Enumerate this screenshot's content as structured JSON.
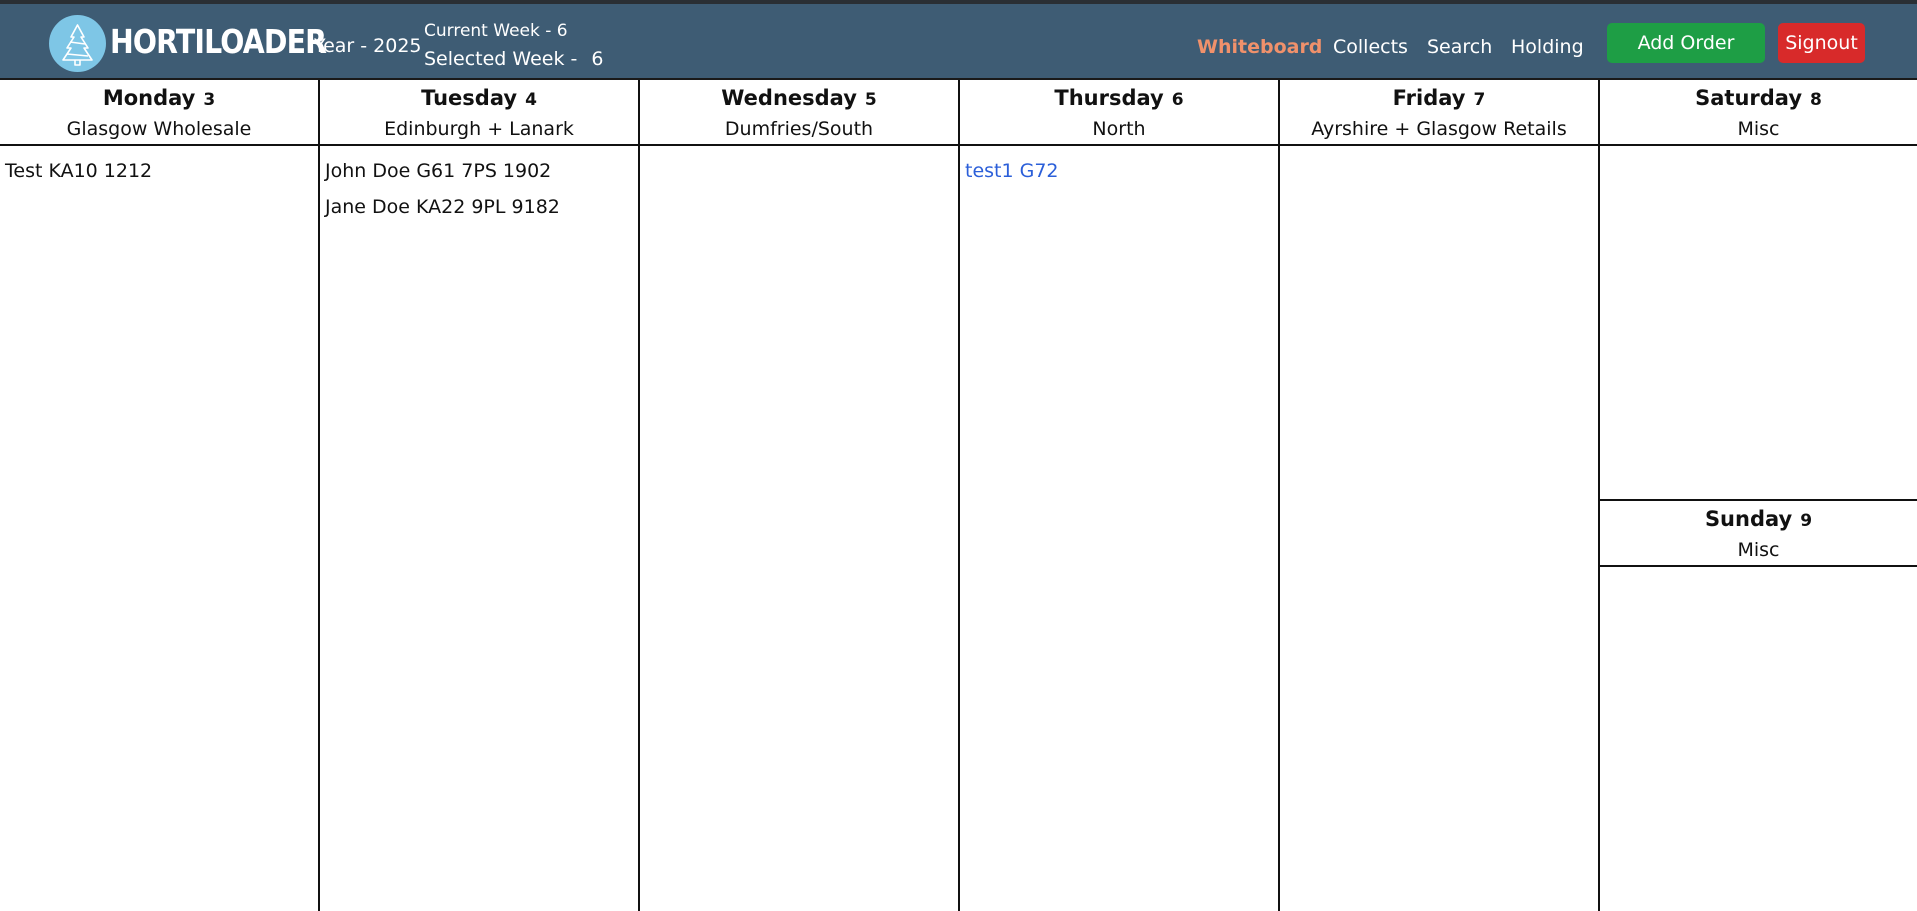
{
  "header": {
    "brand": "HORTILOADER",
    "year_text": "Year - 2025",
    "current_week_text": "Current Week - 6",
    "selected_week_label": "Selected Week -",
    "selected_week_value": "6",
    "nav": [
      "Whiteboard",
      "Collects",
      "Search",
      "Holding"
    ],
    "active_nav": "Whiteboard",
    "add_order_label": "Add Order",
    "signout_label": "Signout",
    "colors": {
      "navbar": "#3e5c74",
      "active": "#f0916b",
      "add": "#1e9e45",
      "signout": "#d82a2a",
      "order_link": "#2b5fd9"
    }
  },
  "days": [
    {
      "name": "Monday",
      "num": "3",
      "region": "Glasgow Wholesale",
      "orders": [
        {
          "text": "Test KA10 1212"
        }
      ]
    },
    {
      "name": "Tuesday",
      "num": "4",
      "region": "Edinburgh + Lanark",
      "orders": [
        {
          "text": "John Doe G61 7PS 1902"
        },
        {
          "text": "Jane Doe KA22 9PL 9182"
        }
      ]
    },
    {
      "name": "Wednesday",
      "num": "5",
      "region": "Dumfries/South",
      "orders": []
    },
    {
      "name": "Thursday",
      "num": "6",
      "region": "North",
      "orders": [
        {
          "text": "test1 G72",
          "highlight": true
        }
      ]
    },
    {
      "name": "Friday",
      "num": "7",
      "region": "Ayrshire + Glasgow Retails",
      "orders": []
    },
    {
      "name": "Saturday",
      "num": "8",
      "region": "Misc",
      "orders": []
    },
    {
      "name": "Sunday",
      "num": "9",
      "region": "Misc",
      "orders": []
    }
  ]
}
